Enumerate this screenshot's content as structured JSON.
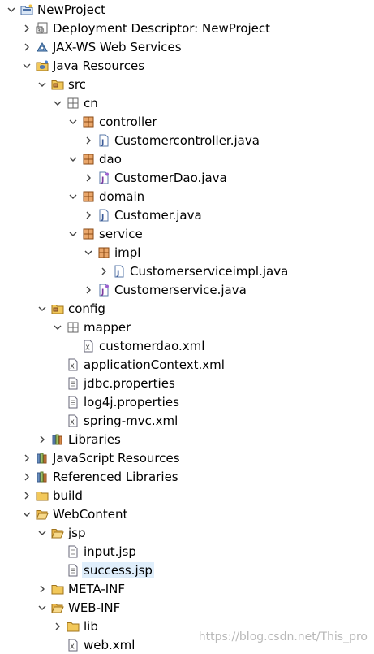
{
  "tree": [
    {
      "label": "NewProject",
      "depth": 0,
      "toggle": "expanded",
      "icon": "project-icon"
    },
    {
      "label": "Deployment Descriptor: NewProject",
      "depth": 1,
      "toggle": "collapsed",
      "icon": "deployment-descriptor-icon"
    },
    {
      "label": "JAX-WS Web Services",
      "depth": 1,
      "toggle": "collapsed",
      "icon": "web-services-icon"
    },
    {
      "label": "Java Resources",
      "depth": 1,
      "toggle": "expanded",
      "icon": "java-resources-icon"
    },
    {
      "label": "src",
      "depth": 2,
      "toggle": "expanded",
      "icon": "source-folder-icon"
    },
    {
      "label": "cn",
      "depth": 3,
      "toggle": "expanded",
      "icon": "empty-package-icon"
    },
    {
      "label": "controller",
      "depth": 4,
      "toggle": "expanded",
      "icon": "package-icon"
    },
    {
      "label": "Customercontroller.java",
      "depth": 5,
      "toggle": "collapsed",
      "icon": "java-file-icon"
    },
    {
      "label": "dao",
      "depth": 4,
      "toggle": "expanded",
      "icon": "package-icon"
    },
    {
      "label": "CustomerDao.java",
      "depth": 5,
      "toggle": "collapsed",
      "icon": "java-interface-icon"
    },
    {
      "label": "domain",
      "depth": 4,
      "toggle": "expanded",
      "icon": "package-icon"
    },
    {
      "label": "Customer.java",
      "depth": 5,
      "toggle": "collapsed",
      "icon": "java-file-icon"
    },
    {
      "label": "service",
      "depth": 4,
      "toggle": "expanded",
      "icon": "package-icon"
    },
    {
      "label": "impl",
      "depth": 5,
      "toggle": "expanded",
      "icon": "package-icon"
    },
    {
      "label": "Customerserviceimpl.java",
      "depth": 6,
      "toggle": "collapsed",
      "icon": "java-file-icon"
    },
    {
      "label": "Customerservice.java",
      "depth": 5,
      "toggle": "collapsed",
      "icon": "java-interface-icon"
    },
    {
      "label": "config",
      "depth": 2,
      "toggle": "expanded",
      "icon": "source-folder-icon"
    },
    {
      "label": "mapper",
      "depth": 3,
      "toggle": "expanded",
      "icon": "empty-package-icon"
    },
    {
      "label": "customerdao.xml",
      "depth": 4,
      "toggle": "none",
      "icon": "xml-file-icon"
    },
    {
      "label": "applicationContext.xml",
      "depth": 3,
      "toggle": "none",
      "icon": "xml-file-icon"
    },
    {
      "label": "jdbc.properties",
      "depth": 3,
      "toggle": "none",
      "icon": "text-file-icon"
    },
    {
      "label": "log4j.properties",
      "depth": 3,
      "toggle": "none",
      "icon": "text-file-icon"
    },
    {
      "label": "spring-mvc.xml",
      "depth": 3,
      "toggle": "none",
      "icon": "xml-file-icon"
    },
    {
      "label": "Libraries",
      "depth": 2,
      "toggle": "collapsed",
      "icon": "libraries-icon"
    },
    {
      "label": "JavaScript Resources",
      "depth": 1,
      "toggle": "collapsed",
      "icon": "libraries-icon"
    },
    {
      "label": "Referenced Libraries",
      "depth": 1,
      "toggle": "collapsed",
      "icon": "libraries-icon"
    },
    {
      "label": "build",
      "depth": 1,
      "toggle": "collapsed",
      "icon": "folder-icon"
    },
    {
      "label": "WebContent",
      "depth": 1,
      "toggle": "expanded",
      "icon": "folder-open-icon"
    },
    {
      "label": "jsp",
      "depth": 2,
      "toggle": "expanded",
      "icon": "folder-open-icon"
    },
    {
      "label": "input.jsp",
      "depth": 3,
      "toggle": "none",
      "icon": "text-file-icon"
    },
    {
      "label": "success.jsp",
      "depth": 3,
      "toggle": "none",
      "icon": "text-file-icon",
      "selected": true
    },
    {
      "label": "META-INF",
      "depth": 2,
      "toggle": "collapsed",
      "icon": "folder-icon"
    },
    {
      "label": "WEB-INF",
      "depth": 2,
      "toggle": "expanded",
      "icon": "folder-open-icon"
    },
    {
      "label": "lib",
      "depth": 3,
      "toggle": "collapsed",
      "icon": "folder-icon"
    },
    {
      "label": "web.xml",
      "depth": 3,
      "toggle": "none",
      "icon": "xml-file-icon"
    }
  ],
  "watermark": "https://blog.csdn.net/This_pro",
  "colors": {
    "selection": "#dfeefb",
    "folder": "#e8b03a",
    "package": "#a0522d",
    "watermark": "#b8b8b8"
  }
}
